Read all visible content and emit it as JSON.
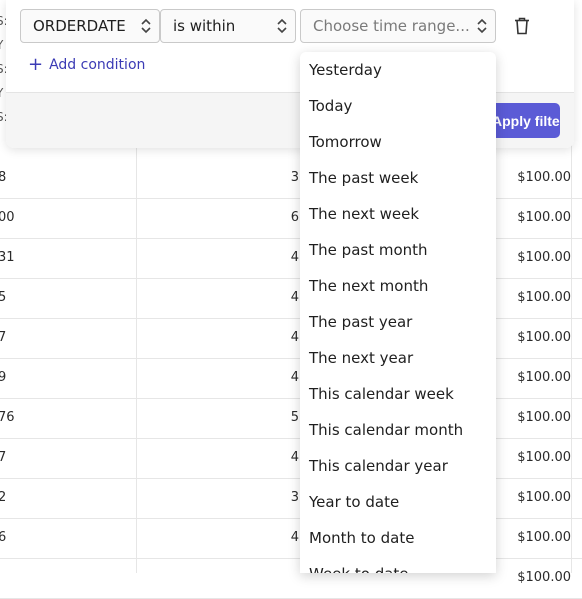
{
  "filter": {
    "field_value": "ORDERDATE",
    "operator_value": "is within",
    "range_placeholder": "Choose time range...",
    "add_condition_label": "Add condition",
    "apply_label": "Apply filters"
  },
  "dropdown": {
    "options": [
      "Yesterday",
      "Today",
      "Tomorrow",
      "The past week",
      "The next week",
      "The past month",
      "The next month",
      "The past year",
      "The next year",
      "This calendar week",
      "This calendar month",
      "This calendar year",
      "Year to date",
      "Month to date",
      "Week to date"
    ]
  },
  "table": {
    "header_fragments": [
      "S:",
      "Y",
      "S:",
      "Y",
      "S:"
    ],
    "rows": [
      {
        "id": "8",
        "qty": "3",
        "price": "$100.00"
      },
      {
        "id": "00",
        "qty": "6",
        "price": "$100.00"
      },
      {
        "id": "31",
        "qty": "4",
        "price": "$100.00"
      },
      {
        "id": "5",
        "qty": "4",
        "price": "$100.00"
      },
      {
        "id": "7",
        "qty": "4",
        "price": "$100.00"
      },
      {
        "id": "9",
        "qty": "4",
        "price": "$100.00"
      },
      {
        "id": "76",
        "qty": "5",
        "price": "$100.00"
      },
      {
        "id": "7",
        "qty": "4",
        "price": "$100.00"
      },
      {
        "id": "2",
        "qty": "3",
        "price": "$100.00"
      },
      {
        "id": "6",
        "qty": "4",
        "price": "$100.00"
      },
      {
        "id": "",
        "qty": "",
        "price": "$100.00"
      }
    ]
  },
  "colors": {
    "accent": "#5b5bd6",
    "link": "#3b3bb5"
  }
}
